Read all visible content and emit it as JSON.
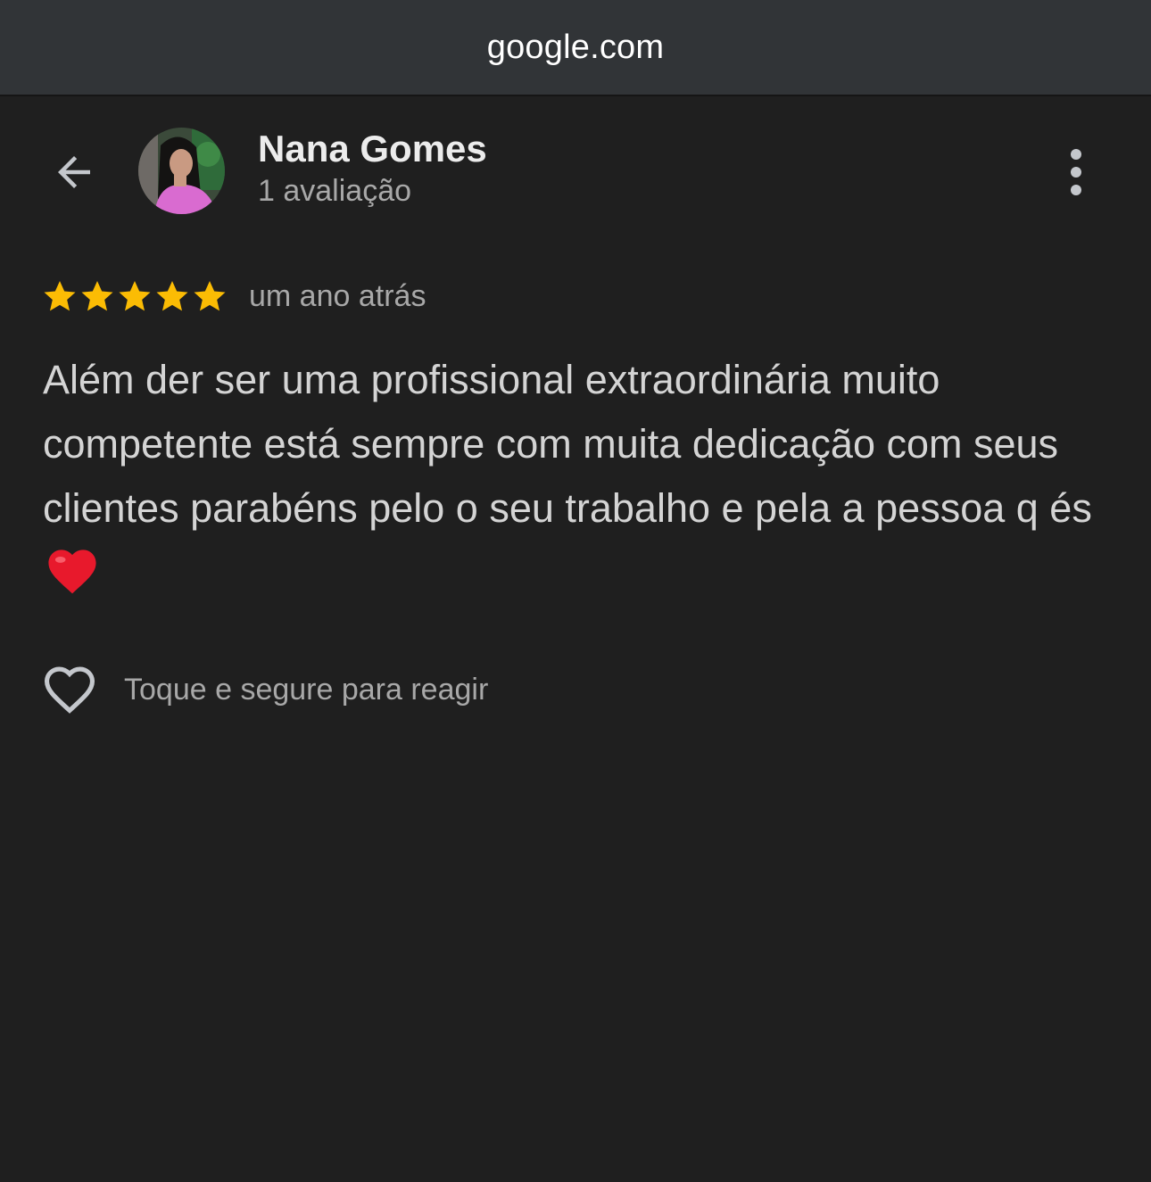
{
  "browser": {
    "url": "google.com"
  },
  "reviewer": {
    "name": "Nana Gomes",
    "review_count": "1 avaliação",
    "avatar_icon": "profile-photo"
  },
  "review": {
    "rating": 5,
    "rating_max": 5,
    "date": "um ano atrás",
    "text": "Além der ser uma profissional extraordinária muito competente está sempre com muita dedicação com seus clientes parabéns pelo o seu trabalho e pela a pessoa q és",
    "emoji": "red-heart-emoji"
  },
  "actions": {
    "react_label": "Toque e segure para reagir",
    "react_icon": "heart-outline-icon",
    "back_icon": "arrow-back-icon",
    "more_icon": "more-vert-icon"
  },
  "colors": {
    "background": "#1f1f1f",
    "url_bar": "#313437",
    "star": "#fbbc04",
    "heart": "#e8192c",
    "secondary_text": "#a8a8a8"
  }
}
